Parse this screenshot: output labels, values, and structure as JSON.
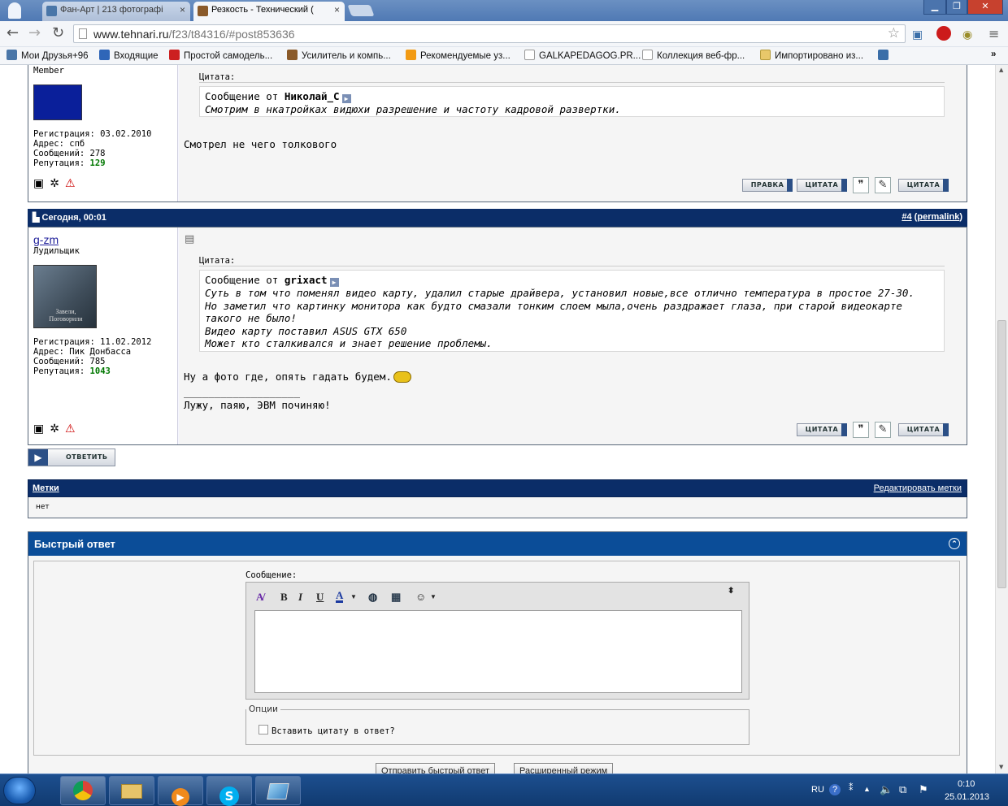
{
  "browser": {
    "tabs": [
      {
        "title": "Фан-Арт | 213 фотографі",
        "close": "×"
      },
      {
        "title": "Резкость - Технический (",
        "close": "×"
      }
    ],
    "url_host": "www.tehnari.ru",
    "url_path": "/f23/t84316/#post853636",
    "bookmarks": [
      "Мои Друзья+96",
      "Входящие",
      "Простой самодель...",
      "Усилитель и компь...",
      "Рекомендуемые уз...",
      "GALKAPEDAGOG.PR...",
      "Коллекция веб-фр...",
      "Импортировано из..."
    ],
    "more": "»"
  },
  "post1": {
    "role": "Member",
    "reg": "Регистрация: 03.02.2010",
    "addr": "Адрес: спб",
    "msgs": "Сообщений: 278",
    "rep_label": "Репутация:",
    "rep": "129",
    "quote_label": "Цитата:",
    "quote_from_prefix": "Сообщение от",
    "quote_author": "Николай_С",
    "quote_lines": [
      "Смотрим в нкатройках видюхи разрешение и частоту кадровой развертки."
    ],
    "text": "Смотрел не чего толкового",
    "buttons": {
      "edit": "ПРАВКА",
      "quote": "ЦИТАТА",
      "multiquote": "ЦИТАТА"
    }
  },
  "post2": {
    "date": "Сегодня, 00:01",
    "num": "#4",
    "permalink": "permalink",
    "user": "g-zm",
    "role": "Лудильщик",
    "avatar_text": "Завели, Поговорили",
    "reg": "Регистрация: 11.02.2012",
    "addr": "Адрес: Пик Донбасса",
    "msgs": "Сообщений: 785",
    "rep_label": "Репутация:",
    "rep": "1043",
    "quote_label": "Цитата:",
    "quote_from_prefix": "Сообщение от",
    "quote_author": "grixact",
    "quote_lines": [
      "Суть в том что поменял видео карту, удалил старые драйвера, установил новые,все отлично температура в простое 27-30.",
      "Но заметил что картинку монитора как будто смазали тонким слоем мыла,очень раздражает глаза, при старой видеокарте такого не было!",
      "Видео карту поставил ASUS GTX 650",
      "Может кто сталкивался и знает решение проблемы."
    ],
    "text": "Ну а фото где, опять гадать будем.",
    "sig_line": "___________________",
    "signature": "Лужу, паяю, ЭВМ починяю!",
    "buttons": {
      "quote": "ЦИТАТА",
      "multiquote": "ЦИТАТА"
    }
  },
  "reply_button": "ОТВЕТИТЬ",
  "tags": {
    "title": "Метки",
    "edit": "Редактировать метки",
    "value": "нет"
  },
  "quick_reply": {
    "title": "Быстрый ответ",
    "message_label": "Сообщение:",
    "options_legend": "Опции",
    "insert_quote": "Вставить цитату в ответ?",
    "submit": "Отправить быстрый ответ",
    "advanced": "Расширенный режим"
  },
  "taskbar": {
    "lang": "RU",
    "time": "0:10",
    "date": "25.01.2013"
  },
  "colors": {
    "header_blue": "#0b2d68",
    "qr_blue": "#0b4d98",
    "rep_green": "#007700"
  }
}
